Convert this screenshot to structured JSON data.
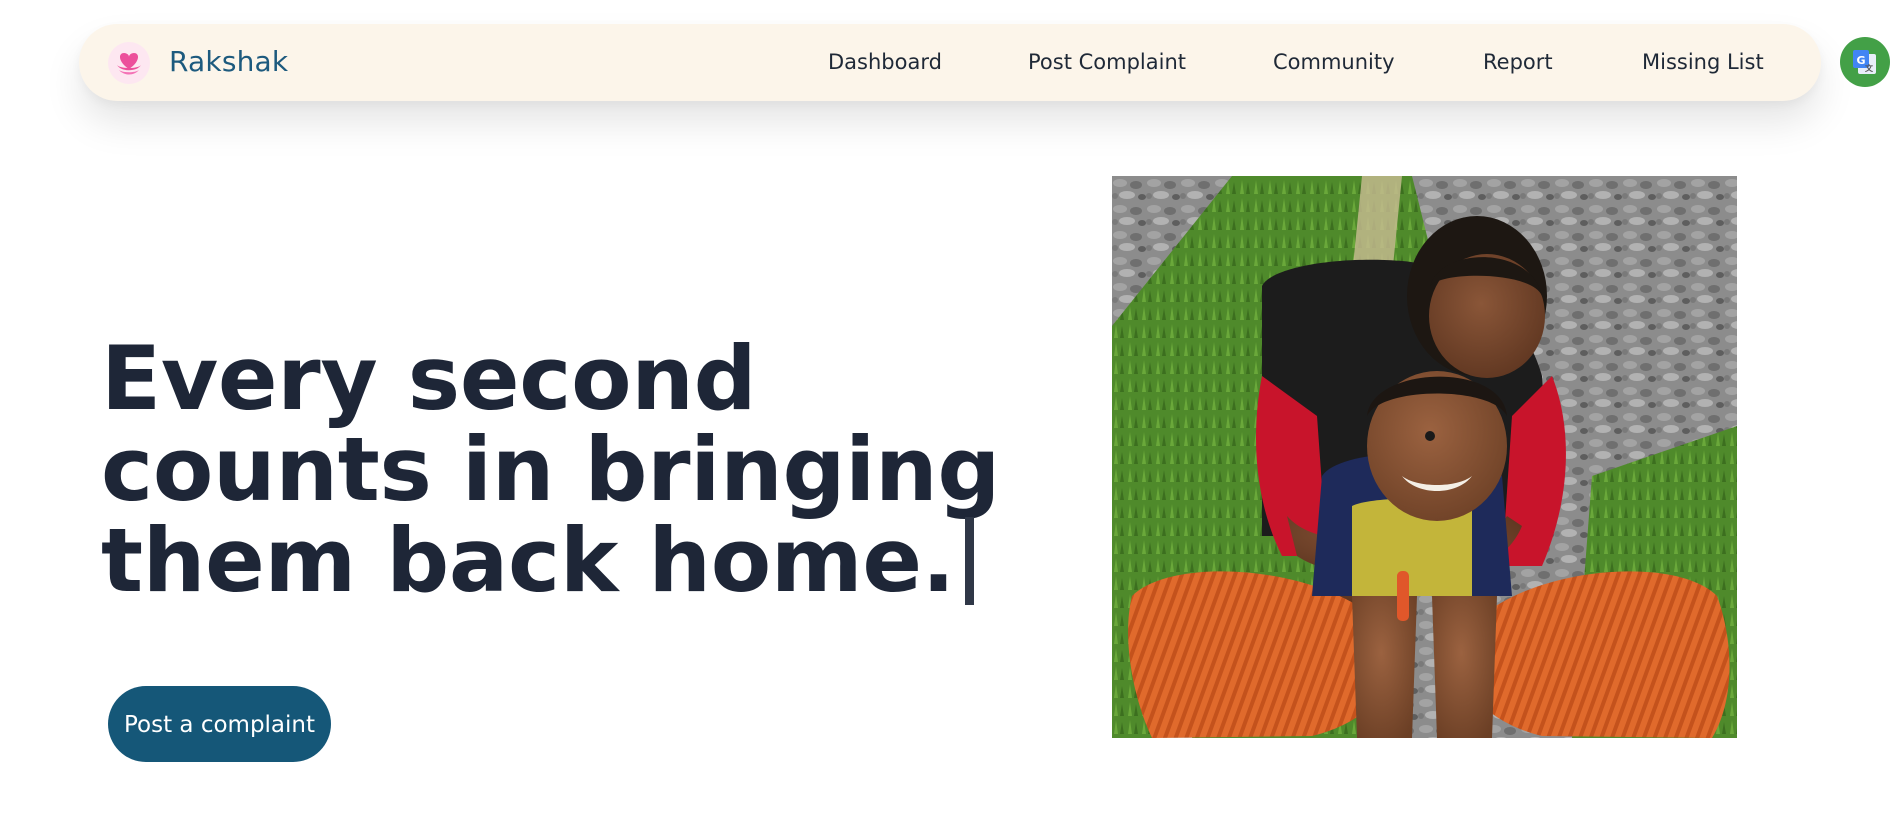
{
  "navbar": {
    "brand_name": "Rakshak",
    "logo_icon": "heart-hands-logo",
    "items": [
      {
        "label": "Dashboard"
      },
      {
        "label": "Post Complaint"
      },
      {
        "label": "Community"
      },
      {
        "label": "Report"
      },
      {
        "label": "Missing List"
      }
    ],
    "translate_icon": "google-translate-icon"
  },
  "hero": {
    "headline_lines": [
      "Every second",
      "counts in bringing",
      "them back home."
    ],
    "cta_label": "Post a complaint",
    "image_icon": "mother-and-child-photo"
  },
  "colors": {
    "brand": "#1d5a7e",
    "navbar_bg": "#fcf5ea",
    "cta_bg": "#155778",
    "headline": "#1e2637",
    "translate_bg": "#43a047",
    "logo_pink": "#ec4f9b"
  }
}
